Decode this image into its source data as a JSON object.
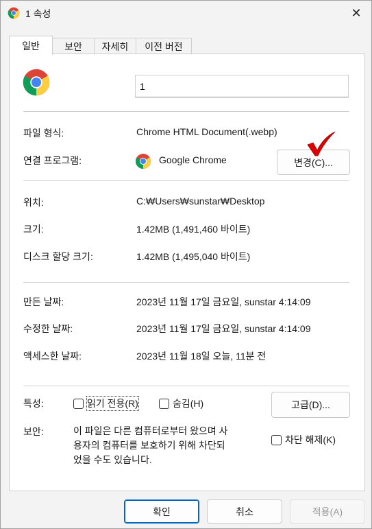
{
  "window": {
    "title": "1 속성",
    "close_glyph": "✕"
  },
  "tabs": [
    {
      "label": "일반",
      "active": true
    },
    {
      "label": "보안"
    },
    {
      "label": "자세히"
    },
    {
      "label": "이전 버전"
    }
  ],
  "general": {
    "file_name": "1",
    "file_type": {
      "label": "파일 형식:",
      "value": "Chrome HTML Document(.webp)"
    },
    "opens_with": {
      "label": "연결 프로그램:",
      "value": "Google Chrome",
      "change_button": "변경(C)..."
    },
    "location": {
      "label": "위치:",
      "value": "C:₩Users₩sunstar₩Desktop"
    },
    "size": {
      "label": "크기:",
      "value": "1.42MB (1,491,460 바이트)"
    },
    "size_on_disk": {
      "label": "디스크 할당 크기:",
      "value": "1.42MB (1,495,040 바이트)"
    },
    "created": {
      "label": "만든 날짜:",
      "value": "2023년 11월 17일 금요일, sunstar 4:14:09"
    },
    "modified": {
      "label": "수정한 날짜:",
      "value": "2023년 11월 17일 금요일, sunstar 4:14:09"
    },
    "accessed": {
      "label": "액세스한 날짜:",
      "value": "2023년 11월 18일 오늘, 11분 전"
    },
    "attributes": {
      "label": "특성:",
      "read_only": "읽기 전용(R)",
      "hidden": "숨김(H)",
      "advanced_button": "고급(D)..."
    },
    "security": {
      "label": "보안:",
      "text_line1": "이 파일은 다른 컴퓨터로부터 왔으며 사",
      "text_line2": "용자의 컴퓨터를 보호하기 위해 차단되",
      "text_line3": "었을 수도 있습니다.",
      "unblock": "차단 해제(K)"
    }
  },
  "footer": {
    "ok": "확인",
    "cancel": "취소",
    "apply": "적용(A)"
  },
  "colors": {
    "accent": "#0067c0",
    "checkmark": "#e00000"
  }
}
